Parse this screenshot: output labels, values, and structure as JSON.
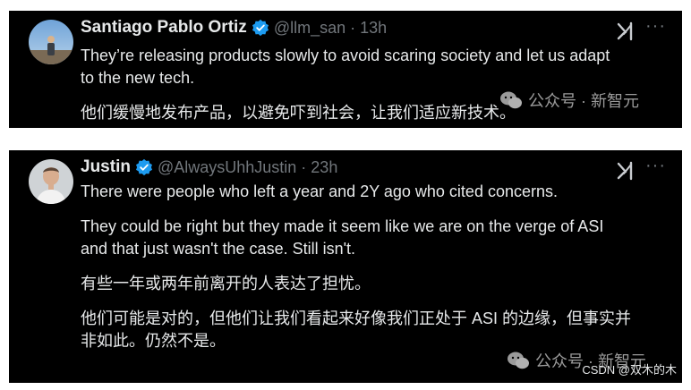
{
  "tweets": [
    {
      "author_name": "Santiago Pablo Ortiz",
      "handle": "@llm_san",
      "separator": "·",
      "time": "13h",
      "lines": [
        "They’re releasing products slowly to avoid scaring society and let us adapt",
        "to the new tech.",
        "他们缓慢地发布产品，以避免吓到社会，让我们适应新技术。"
      ]
    },
    {
      "author_name": "Justin",
      "handle": "@AlwaysUhhJustin",
      "separator": "·",
      "time": "23h",
      "lines": [
        "There were people who left a year and 2Y ago who cited concerns.",
        "They could be right but they made it seem like we are on the verge of ASI",
        "and that just wasn't the case. Still isn't.",
        "有些一年或两年前离开的人表达了担忧。",
        "他们可能是对的，但他们让我们看起来好像我们正处于 ASI 的边缘，但事实并",
        "非如此。仍然不是。"
      ]
    }
  ],
  "more_label": "···",
  "watermark": {
    "text": "公众号 · 新智元"
  },
  "footer": {
    "credit": "CSDN @双木的木"
  },
  "colors": {
    "background": "#000000",
    "text": "#e7e9ea",
    "muted": "#71767b",
    "verified": "#1d9bf0"
  }
}
